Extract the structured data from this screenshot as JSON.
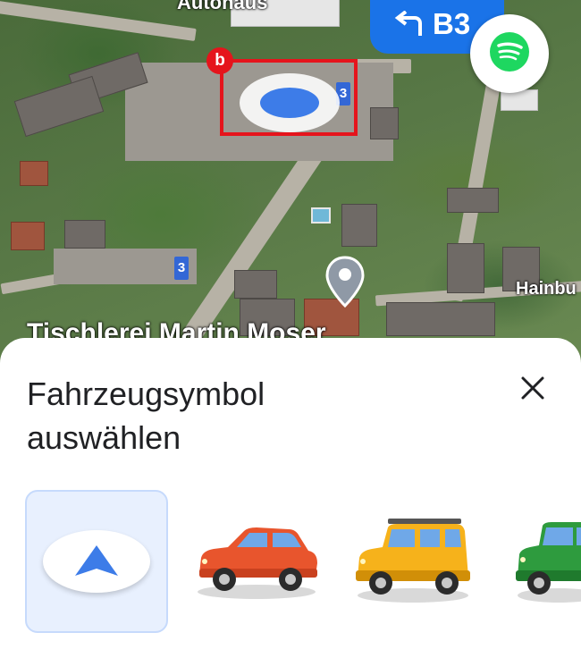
{
  "map": {
    "labels": {
      "autohaus": "Autohaus",
      "hainbu": "Hainbu",
      "tischlerei": "Tischlerei Martin Moser"
    },
    "route_shields": [
      "3",
      "3"
    ],
    "icons": {
      "position_marker": "navigation-position-icon",
      "destination_pin": "map-pin-icon"
    }
  },
  "navigation": {
    "turn_icon": "turn-left-arrow-icon",
    "road_name": "B3",
    "banner_color": "#1a73e8"
  },
  "spotify": {
    "icon": "spotify-icon",
    "color": "#1ed760"
  },
  "annotation": {
    "label": "b",
    "color": "#e5141c"
  },
  "vehicle_picker": {
    "title": "Fahrzeugsymbol auswählen",
    "close_icon": "close-icon",
    "options": [
      {
        "icon": "navigation-arrow-icon",
        "selected": true,
        "color": "#1a73e8"
      },
      {
        "icon": "red-car-icon",
        "selected": false,
        "color": "#e8552d"
      },
      {
        "icon": "yellow-suv-icon",
        "selected": false,
        "color": "#f6b21b"
      },
      {
        "icon": "green-jeep-icon",
        "selected": false,
        "color": "#2e9b3e"
      }
    ]
  }
}
